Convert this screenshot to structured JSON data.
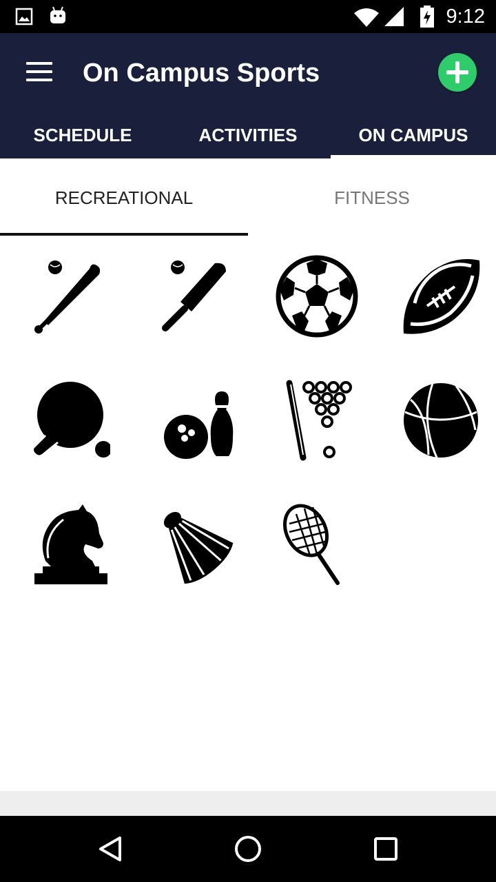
{
  "status_bar": {
    "time": "9:12",
    "icons": [
      "gallery-notification-icon",
      "android-notification-icon",
      "wifi-icon",
      "cell-signal-icon",
      "battery-charging-icon"
    ]
  },
  "app_bar": {
    "title": "On Campus Sports",
    "menu_icon": "hamburger-menu-icon",
    "add_icon": "add-circle-icon",
    "add_color": "#2ecc6b",
    "background_color": "#1a1f3b"
  },
  "top_tabs": [
    {
      "label": "SCHEDULE",
      "active": false
    },
    {
      "label": "ACTIVITIES",
      "active": false
    },
    {
      "label": "ON CAMPUS",
      "active": true
    }
  ],
  "sub_tabs": [
    {
      "label": "RECREATIONAL",
      "active": true
    },
    {
      "label": "FITNESS",
      "active": false
    }
  ],
  "sports": [
    {
      "icon": "baseball-bat-icon"
    },
    {
      "icon": "cricket-bat-icon"
    },
    {
      "icon": "soccer-ball-icon"
    },
    {
      "icon": "american-football-icon"
    },
    {
      "icon": "table-tennis-icon"
    },
    {
      "icon": "bowling-icon"
    },
    {
      "icon": "billiards-icon"
    },
    {
      "icon": "basketball-icon"
    },
    {
      "icon": "chess-knight-icon"
    },
    {
      "icon": "badminton-shuttlecock-icon"
    },
    {
      "icon": "squash-racket-icon"
    }
  ],
  "nav_bar": {
    "icons": [
      "back-icon",
      "home-icon",
      "recents-icon"
    ]
  }
}
